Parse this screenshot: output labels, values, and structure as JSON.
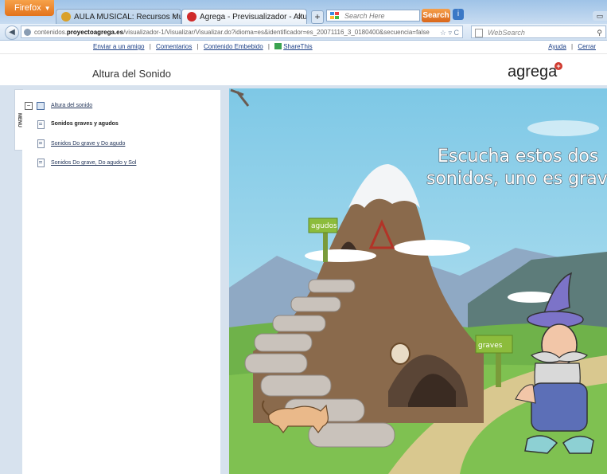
{
  "browser": {
    "app_button": "Firefox",
    "tabs": [
      {
        "title": "AULA MUSICAL: Recursos Musicales",
        "close": "×"
      },
      {
        "title": "Agrega - Previsualizador - Altura del ...",
        "close": "×"
      }
    ],
    "new_tab": "+",
    "toolbar_search_placeholder": "Search Here",
    "toolbar_search_button": "Search",
    "url_prefix": "contenidos.",
    "url_domain": "proyectoagrega.es",
    "url_path": "/visualizador-1/Visualizar/Visualizar.do?idioma=es&identificador=es_20071116_3_0180400&secuencia=false",
    "web_search_placeholder": "WebSearch"
  },
  "header": {
    "links": [
      "Enviar a un amigo",
      "Comentarios",
      "Contenido Embebido",
      "ShareThis"
    ],
    "separator": "|",
    "right_links": [
      "Ayuda",
      "Cerrar"
    ],
    "title": "Altura del Sonido",
    "logo": "agrega"
  },
  "sidebar": {
    "menu_tab": "MENU",
    "root": "Altura del sonido",
    "items": [
      {
        "label": "Sonidos graves y agudos",
        "current": true
      },
      {
        "label": "Sonidos Do grave y Do agudo",
        "current": false
      },
      {
        "label": "Sonidos Do grave, Do agudo y Sol",
        "current": false
      }
    ]
  },
  "stage": {
    "instruction_line1": "Escucha estos dos",
    "instruction_line2": "sonidos, uno es grave",
    "sign_high": "agudos",
    "sign_low": "graves"
  }
}
